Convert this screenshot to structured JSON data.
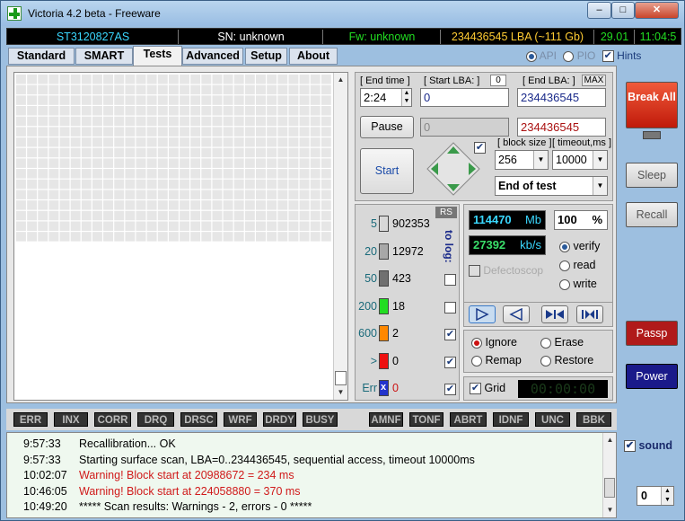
{
  "app": {
    "title": "Victoria 4.2 beta - Freeware",
    "brand_color": "#1a9a1a"
  },
  "window_buttons": {
    "minimize": "–",
    "maximize": "□",
    "close": "✕"
  },
  "infobar": {
    "model": "ST3120827AS",
    "serial": "SN: unknown",
    "firmware": "Fw: unknown",
    "lba": "234436545 LBA (~111 Gb)",
    "date": "29.01",
    "time": "11:04:5"
  },
  "tabs": [
    "Standard",
    "SMART",
    "Tests",
    "Advanced",
    "Setup",
    "About"
  ],
  "active_tab": "Tests",
  "mode": {
    "api_label": "API",
    "pio_label": "PIO",
    "hints_label": "Hints",
    "hints_checked": true
  },
  "controls": {
    "end_time_label": "[ End time ]",
    "end_time": "2:24",
    "start_lba_label": "[ Start LBA: ]",
    "start_lba_box": "0",
    "start_lba": "0",
    "end_lba_label": "[ End LBA: ]",
    "end_lba_max": "MAX",
    "end_lba": "234436545",
    "current_lba": "0",
    "current_end_lba": "234436545",
    "pause_label": "Pause",
    "start_label": "Start",
    "block_size_label": "[ block size ]",
    "block_size": "256",
    "timeout_label": "[ timeout,ms ]",
    "timeout": "10000",
    "end_action": "End of test"
  },
  "stats": {
    "rs_label": "RS",
    "to_log_label": "to log:",
    "rows": [
      {
        "threshold": "5",
        "count": "902353",
        "color": "#d8d8d8",
        "log_checked": false
      },
      {
        "threshold": "20",
        "count": "12972",
        "color": "#a8a8a8",
        "log_checked": false
      },
      {
        "threshold": "50",
        "count": "423",
        "color": "#707070",
        "log_checked": false
      },
      {
        "threshold": "200",
        "count": "18",
        "color": "#22dd22",
        "log_checked": false
      },
      {
        "threshold": "600",
        "count": "2",
        "color": "#ff8800",
        "log_checked": true
      },
      {
        "threshold": ">",
        "count": "0",
        "color": "#ee1111",
        "log_checked": true
      },
      {
        "threshold": "Err",
        "count": "0",
        "color": "#2233cc",
        "log_checked": true
      }
    ]
  },
  "progress": {
    "processed": "114470",
    "processed_unit": "Mb",
    "percent": "100",
    "percent_unit": "%",
    "speed": "27392",
    "speed_unit": "kb/s",
    "defectoscope_label": "Defectoscop",
    "mode_options": [
      "verify",
      "read",
      "write"
    ],
    "mode_selected": "verify"
  },
  "actions": {
    "options": [
      "Ignore",
      "Erase",
      "Remap",
      "Restore"
    ],
    "selected": "Ignore",
    "grid_label": "Grid",
    "grid_checked": true,
    "timer": "00:00:00"
  },
  "error_keys": [
    "ERR",
    "INX",
    "CORR",
    "DRQ",
    "DRSC",
    "WRF",
    "DRDY",
    "BUSY",
    "AMNF",
    "TONF",
    "ABRT",
    "IDNF",
    "UNC",
    "BBK"
  ],
  "log": [
    {
      "time": "9:57:33",
      "msg": "Recallibration... OK",
      "warn": false
    },
    {
      "time": "9:57:33",
      "msg": "Starting surface scan, LBA=0..234436545, sequential access, timeout 10000ms",
      "warn": false
    },
    {
      "time": "10:02:07",
      "msg": "Warning! Block start at 20988672 = 234 ms",
      "warn": true
    },
    {
      "time": "10:46:05",
      "msg": "Warning! Block start at 224058880 = 370 ms",
      "warn": true
    },
    {
      "time": "10:49:20",
      "msg": "***** Scan results: Warnings - 2, errors - 0 *****",
      "warn": false
    }
  ],
  "side": {
    "break_all": "Break All",
    "sleep": "Sleep",
    "recall": "Recall",
    "passp": "Passp",
    "power": "Power",
    "sound_label": "sound",
    "sound_checked": true,
    "spin_value": "0"
  },
  "surface_map": {
    "cols": 29,
    "rows": 31,
    "filled": 464,
    "gray": [
      [
        15,
        16
      ],
      [
        17,
        17
      ],
      [
        25,
        19
      ],
      [
        27,
        20
      ],
      [
        29,
        4
      ],
      [
        30,
        20
      ],
      [
        34,
        10
      ],
      [
        39,
        17
      ],
      [
        40,
        23
      ],
      [
        40,
        11
      ],
      [
        42,
        14
      ],
      [
        47,
        19
      ]
    ],
    "dark": [
      [
        41,
        15
      ],
      [
        41,
        19
      ]
    ]
  }
}
